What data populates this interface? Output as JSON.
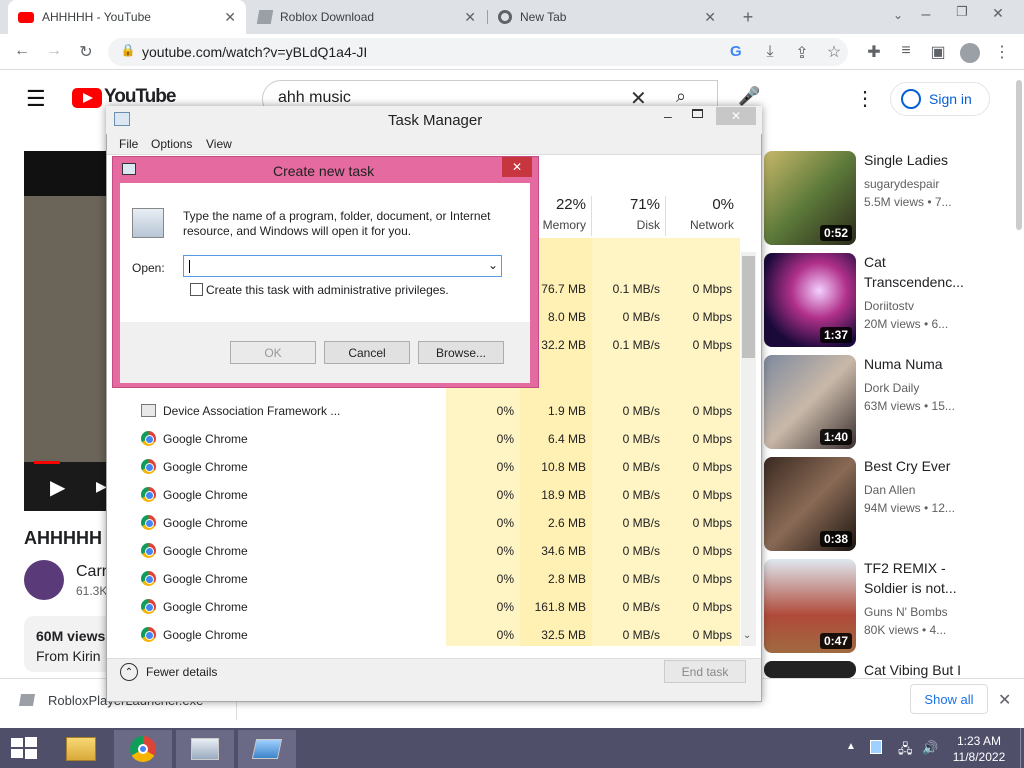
{
  "browser": {
    "tabs": [
      {
        "title": "AHHHHH - YouTube"
      },
      {
        "title": "Roblox Download"
      },
      {
        "title": "New Tab"
      }
    ],
    "url": "youtube.com/watch?v=yBLdQ1a4-JI"
  },
  "youtube": {
    "logo_text": "YouTube",
    "search_query": "ahh music",
    "signin_label": "Sign in",
    "video_title": "AHHHHH",
    "channel_name": "Carr",
    "channel_subs": "61.3K",
    "desc_views": "60M views",
    "desc_from": "From Kirin",
    "recommendations": [
      {
        "title": "Single Ladies",
        "channel": "sugarydespair",
        "meta": "5.5M views • 7...",
        "duration": "0:52"
      },
      {
        "title": "Cat",
        "title2": "Transcendenc...",
        "channel": "Doriitostv",
        "meta": "20M views • 6...",
        "duration": "1:37"
      },
      {
        "title": "Numa Numa",
        "channel": "Dork Daily",
        "meta": "63M views • 15...",
        "duration": "1:40"
      },
      {
        "title": "Best Cry Ever",
        "channel": "Dan Allen",
        "meta": "94M views • 12...",
        "duration": "0:38"
      },
      {
        "title": "TF2 REMIX -",
        "title2": "Soldier is not...",
        "channel": "Guns N' Bombs",
        "meta": "80K views • 4...",
        "duration": "0:47"
      },
      {
        "title": "Cat Vibing But I"
      }
    ]
  },
  "downloads": {
    "file": "RobloxPlayerLauncher.exe",
    "show_all": "Show all"
  },
  "task_manager": {
    "title": "Task Manager",
    "menu": [
      "File",
      "Options",
      "View"
    ],
    "columns": {
      "memory": {
        "pct": "22%",
        "label": "Memory"
      },
      "disk": {
        "pct": "71%",
        "label": "Disk"
      },
      "network": {
        "pct": "0%",
        "label": "Network"
      }
    },
    "top_rows": [
      {
        "memory": "76.7 MB",
        "disk": "0.1 MB/s",
        "network": "0 Mbps"
      },
      {
        "memory": "8.0 MB",
        "disk": "0 MB/s",
        "network": "0 Mbps"
      },
      {
        "memory": "32.2 MB",
        "disk": "0.1 MB/s",
        "network": "0 Mbps"
      }
    ],
    "processes": [
      {
        "name": "Device Association Framework ...",
        "cpu": "0%",
        "memory": "1.9 MB",
        "disk": "0 MB/s",
        "network": "0 Mbps"
      },
      {
        "name": "Google Chrome",
        "cpu": "0%",
        "memory": "6.4 MB",
        "disk": "0 MB/s",
        "network": "0 Mbps"
      },
      {
        "name": "Google Chrome",
        "cpu": "0%",
        "memory": "10.8 MB",
        "disk": "0 MB/s",
        "network": "0 Mbps"
      },
      {
        "name": "Google Chrome",
        "cpu": "0%",
        "memory": "18.9 MB",
        "disk": "0 MB/s",
        "network": "0 Mbps"
      },
      {
        "name": "Google Chrome",
        "cpu": "0%",
        "memory": "2.6 MB",
        "disk": "0 MB/s",
        "network": "0 Mbps"
      },
      {
        "name": "Google Chrome",
        "cpu": "0%",
        "memory": "34.6 MB",
        "disk": "0 MB/s",
        "network": "0 Mbps"
      },
      {
        "name": "Google Chrome",
        "cpu": "0%",
        "memory": "2.8 MB",
        "disk": "0 MB/s",
        "network": "0 Mbps"
      },
      {
        "name": "Google Chrome",
        "cpu": "0%",
        "memory": "161.8 MB",
        "disk": "0 MB/s",
        "network": "0 Mbps"
      },
      {
        "name": "Google Chrome",
        "cpu": "0%",
        "memory": "32.5 MB",
        "disk": "0 MB/s",
        "network": "0 Mbps"
      }
    ],
    "fewer_details": "Fewer details",
    "end_task": "End task"
  },
  "dialog": {
    "title": "Create new task",
    "description": "Type the name of a program, folder, document, or Internet resource, and Windows will open it for you.",
    "open_label": "Open:",
    "open_value": "",
    "admin_label": "Create this task with administrative privileges.",
    "ok": "OK",
    "cancel": "Cancel",
    "browse": "Browse..."
  },
  "taskbar": {
    "time": "1:23 AM",
    "date": "11/8/2022"
  },
  "colors": {
    "accent_pink": "#e46aa0",
    "youtube_red": "#ff0000",
    "taskbar": "#4f4f6a",
    "highlight": "#fff4c4"
  }
}
